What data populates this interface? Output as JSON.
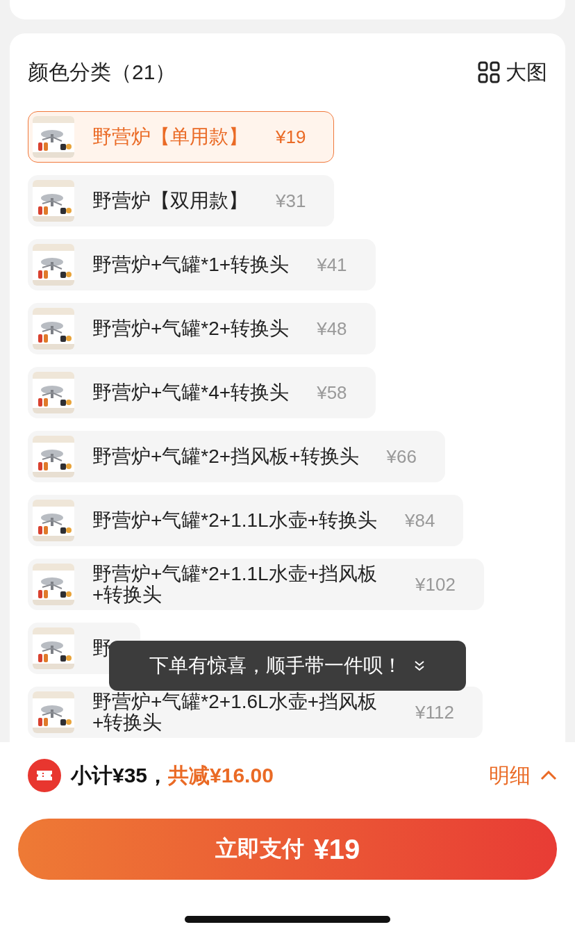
{
  "section": {
    "title": "颜色分类（21）",
    "view_toggle": "大图"
  },
  "options": [
    {
      "label": "野营炉【单用款】",
      "price": "¥19",
      "selected": true
    },
    {
      "label": "野营炉【双用款】",
      "price": "¥31",
      "selected": false
    },
    {
      "label": "野营炉+气罐*1+转换头",
      "price": "¥41",
      "selected": false
    },
    {
      "label": "野营炉+气罐*2+转换头",
      "price": "¥48",
      "selected": false
    },
    {
      "label": "野营炉+气罐*4+转换头",
      "price": "¥58",
      "selected": false
    },
    {
      "label": "野营炉+气罐*2+挡风板+转换头",
      "price": "¥66",
      "selected": false
    },
    {
      "label": "野营炉+气罐*2+1.1L水壶+转换头",
      "price": "¥84",
      "selected": false
    },
    {
      "label": "野营炉+气罐*2+1.1L水壶+挡风板+转换头",
      "price": "¥102",
      "selected": false
    },
    {
      "label": "野",
      "selected": false
    },
    {
      "label": "野营炉+气罐*2+1.6L水壶+挡风板+转换头",
      "price": "¥112",
      "selected": false
    }
  ],
  "toast": {
    "text": "下单有惊喜，顺手带一件呗！"
  },
  "summary": {
    "subtotal": "小计¥35，",
    "discount": "共减¥16.00",
    "details_link": "明细"
  },
  "pay_button": {
    "label": "立即支付",
    "amount": "¥19"
  }
}
